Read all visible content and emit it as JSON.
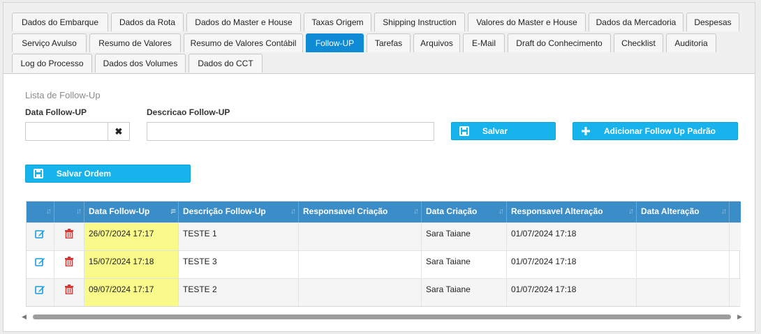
{
  "tabs": [
    {
      "label": "Dados do Embarque"
    },
    {
      "label": "Dados da Rota"
    },
    {
      "label": "Dados do Master e House"
    },
    {
      "label": "Taxas Origem"
    },
    {
      "label": "Shipping Instruction"
    },
    {
      "label": "Valores do Master e House"
    },
    {
      "label": "Dados da Mercadoria"
    },
    {
      "label": "Despesas"
    },
    {
      "label": "Serviço Avulso"
    },
    {
      "label": "Resumo de Valores"
    },
    {
      "label": "Resumo de Valores Contábil"
    },
    {
      "label": "Follow-UP",
      "active": true
    },
    {
      "label": "Tarefas"
    },
    {
      "label": "Arquivos"
    },
    {
      "label": "E-Mail"
    },
    {
      "label": "Draft do Conhecimento"
    },
    {
      "label": "Checklist"
    },
    {
      "label": "Auditoria"
    },
    {
      "label": "Log do Processo"
    },
    {
      "label": "Dados dos Volumes"
    },
    {
      "label": "Dados do CCT"
    }
  ],
  "form": {
    "section_title": "Lista de Follow-Up",
    "date_label": "Data Follow-UP",
    "date_value": "",
    "clear_glyph": "✖",
    "desc_label": "Descricao Follow-UP",
    "desc_value": "",
    "save_label": "Salvar",
    "add_default_label": "Adicionar Follow Up Padrão",
    "save_order_label": "Salvar Ordem"
  },
  "table": {
    "columns": [
      "",
      "",
      "Data Follow-Up",
      "Descrição Follow-Up",
      "Responsavel Criação",
      "Data Criação",
      "Responsavel Alteração",
      "Data Alteração"
    ],
    "rows": [
      {
        "date": "26/07/2024 17:17",
        "description": "TESTE 1",
        "created_by": "",
        "created_at": "Sara Taiane",
        "changed_by": "01/07/2024 17:18",
        "changed_at": ""
      },
      {
        "date": "15/07/2024 17:18",
        "description": "TESTE 3",
        "created_by": "",
        "created_at": "Sara Taiane",
        "changed_by": "01/07/2024 17:18",
        "changed_at": ""
      },
      {
        "date": "09/07/2024 17:17",
        "description": "TESTE 2",
        "created_by": "",
        "created_at": "Sara Taiane",
        "changed_by": "01/07/2024 17:18",
        "changed_at": ""
      }
    ]
  },
  "colors": {
    "accent": "#0f8bd6",
    "button": "#16b3ec",
    "header": "#3b8dc7",
    "highlight": "#fafa8a",
    "edit_icon": "#1a9bd9",
    "delete_icon": "#d9332f"
  }
}
